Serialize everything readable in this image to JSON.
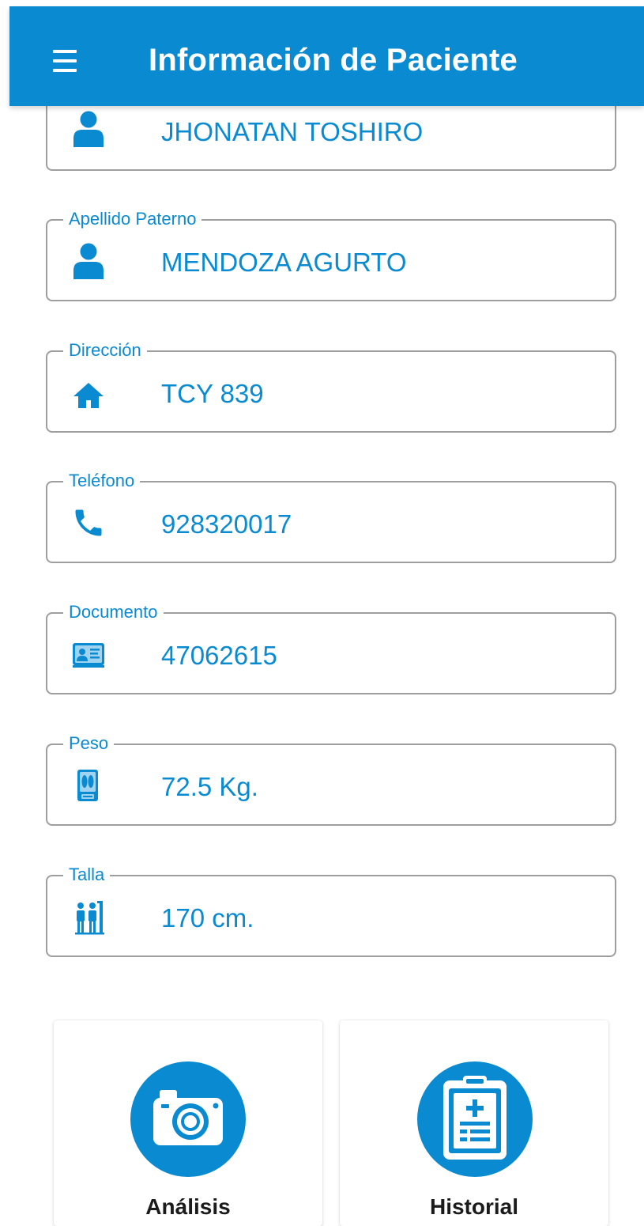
{
  "app": {
    "title": "Información de Paciente",
    "menu_icon": "hamburger-menu-icon",
    "accent_color": "#0a8ad0"
  },
  "fields": {
    "nombre": {
      "label": "",
      "value": "JHONATAN TOSHIRO",
      "icon": "person-icon"
    },
    "apellido_paterno": {
      "label": "Apellido Paterno",
      "value": "MENDOZA AGURTO",
      "icon": "person-icon"
    },
    "direccion": {
      "label": "Dirección",
      "value": "TCY 839",
      "icon": "home-icon"
    },
    "telefono": {
      "label": "Teléfono",
      "value": "928320017",
      "icon": "phone-icon"
    },
    "documento": {
      "label": "Documento",
      "value": "47062615",
      "icon": "id-card-icon"
    },
    "peso": {
      "label": "Peso",
      "value": "72.5 Kg.",
      "icon": "scale-icon"
    },
    "talla": {
      "label": "Talla",
      "value": "170 cm.",
      "icon": "height-measure-icon"
    }
  },
  "actions": {
    "analisis": {
      "label": "Análisis",
      "icon": "camera-icon"
    },
    "historial": {
      "label": "Historial",
      "icon": "clipboard-medical-icon"
    }
  }
}
